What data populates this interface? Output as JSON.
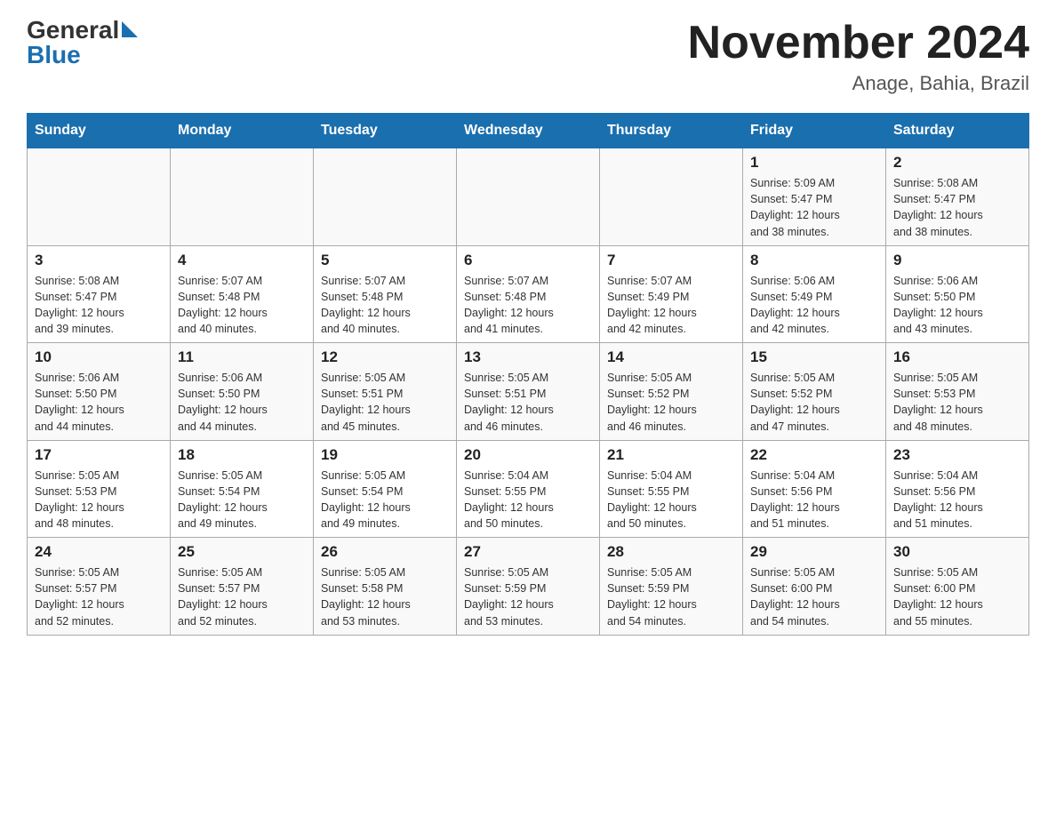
{
  "header": {
    "logo_general": "General",
    "logo_blue": "Blue",
    "title": "November 2024",
    "location": "Anage, Bahia, Brazil"
  },
  "weekdays": [
    "Sunday",
    "Monday",
    "Tuesday",
    "Wednesday",
    "Thursday",
    "Friday",
    "Saturday"
  ],
  "weeks": [
    [
      {
        "day": "",
        "info": ""
      },
      {
        "day": "",
        "info": ""
      },
      {
        "day": "",
        "info": ""
      },
      {
        "day": "",
        "info": ""
      },
      {
        "day": "",
        "info": ""
      },
      {
        "day": "1",
        "info": "Sunrise: 5:09 AM\nSunset: 5:47 PM\nDaylight: 12 hours\nand 38 minutes."
      },
      {
        "day": "2",
        "info": "Sunrise: 5:08 AM\nSunset: 5:47 PM\nDaylight: 12 hours\nand 38 minutes."
      }
    ],
    [
      {
        "day": "3",
        "info": "Sunrise: 5:08 AM\nSunset: 5:47 PM\nDaylight: 12 hours\nand 39 minutes."
      },
      {
        "day": "4",
        "info": "Sunrise: 5:07 AM\nSunset: 5:48 PM\nDaylight: 12 hours\nand 40 minutes."
      },
      {
        "day": "5",
        "info": "Sunrise: 5:07 AM\nSunset: 5:48 PM\nDaylight: 12 hours\nand 40 minutes."
      },
      {
        "day": "6",
        "info": "Sunrise: 5:07 AM\nSunset: 5:48 PM\nDaylight: 12 hours\nand 41 minutes."
      },
      {
        "day": "7",
        "info": "Sunrise: 5:07 AM\nSunset: 5:49 PM\nDaylight: 12 hours\nand 42 minutes."
      },
      {
        "day": "8",
        "info": "Sunrise: 5:06 AM\nSunset: 5:49 PM\nDaylight: 12 hours\nand 42 minutes."
      },
      {
        "day": "9",
        "info": "Sunrise: 5:06 AM\nSunset: 5:50 PM\nDaylight: 12 hours\nand 43 minutes."
      }
    ],
    [
      {
        "day": "10",
        "info": "Sunrise: 5:06 AM\nSunset: 5:50 PM\nDaylight: 12 hours\nand 44 minutes."
      },
      {
        "day": "11",
        "info": "Sunrise: 5:06 AM\nSunset: 5:50 PM\nDaylight: 12 hours\nand 44 minutes."
      },
      {
        "day": "12",
        "info": "Sunrise: 5:05 AM\nSunset: 5:51 PM\nDaylight: 12 hours\nand 45 minutes."
      },
      {
        "day": "13",
        "info": "Sunrise: 5:05 AM\nSunset: 5:51 PM\nDaylight: 12 hours\nand 46 minutes."
      },
      {
        "day": "14",
        "info": "Sunrise: 5:05 AM\nSunset: 5:52 PM\nDaylight: 12 hours\nand 46 minutes."
      },
      {
        "day": "15",
        "info": "Sunrise: 5:05 AM\nSunset: 5:52 PM\nDaylight: 12 hours\nand 47 minutes."
      },
      {
        "day": "16",
        "info": "Sunrise: 5:05 AM\nSunset: 5:53 PM\nDaylight: 12 hours\nand 48 minutes."
      }
    ],
    [
      {
        "day": "17",
        "info": "Sunrise: 5:05 AM\nSunset: 5:53 PM\nDaylight: 12 hours\nand 48 minutes."
      },
      {
        "day": "18",
        "info": "Sunrise: 5:05 AM\nSunset: 5:54 PM\nDaylight: 12 hours\nand 49 minutes."
      },
      {
        "day": "19",
        "info": "Sunrise: 5:05 AM\nSunset: 5:54 PM\nDaylight: 12 hours\nand 49 minutes."
      },
      {
        "day": "20",
        "info": "Sunrise: 5:04 AM\nSunset: 5:55 PM\nDaylight: 12 hours\nand 50 minutes."
      },
      {
        "day": "21",
        "info": "Sunrise: 5:04 AM\nSunset: 5:55 PM\nDaylight: 12 hours\nand 50 minutes."
      },
      {
        "day": "22",
        "info": "Sunrise: 5:04 AM\nSunset: 5:56 PM\nDaylight: 12 hours\nand 51 minutes."
      },
      {
        "day": "23",
        "info": "Sunrise: 5:04 AM\nSunset: 5:56 PM\nDaylight: 12 hours\nand 51 minutes."
      }
    ],
    [
      {
        "day": "24",
        "info": "Sunrise: 5:05 AM\nSunset: 5:57 PM\nDaylight: 12 hours\nand 52 minutes."
      },
      {
        "day": "25",
        "info": "Sunrise: 5:05 AM\nSunset: 5:57 PM\nDaylight: 12 hours\nand 52 minutes."
      },
      {
        "day": "26",
        "info": "Sunrise: 5:05 AM\nSunset: 5:58 PM\nDaylight: 12 hours\nand 53 minutes."
      },
      {
        "day": "27",
        "info": "Sunrise: 5:05 AM\nSunset: 5:59 PM\nDaylight: 12 hours\nand 53 minutes."
      },
      {
        "day": "28",
        "info": "Sunrise: 5:05 AM\nSunset: 5:59 PM\nDaylight: 12 hours\nand 54 minutes."
      },
      {
        "day": "29",
        "info": "Sunrise: 5:05 AM\nSunset: 6:00 PM\nDaylight: 12 hours\nand 54 minutes."
      },
      {
        "day": "30",
        "info": "Sunrise: 5:05 AM\nSunset: 6:00 PM\nDaylight: 12 hours\nand 55 minutes."
      }
    ]
  ]
}
